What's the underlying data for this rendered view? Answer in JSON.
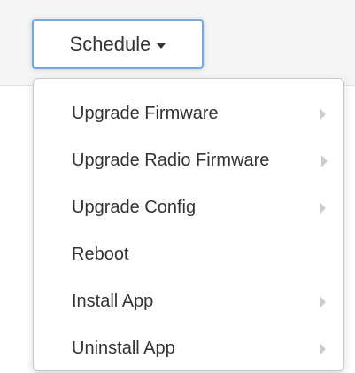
{
  "toolbar": {
    "schedule_label": "Schedule"
  },
  "menu": {
    "items": [
      {
        "label": "Upgrade Firmware",
        "has_submenu": true
      },
      {
        "label": "Upgrade Radio Firmware",
        "has_submenu": true
      },
      {
        "label": "Upgrade Config",
        "has_submenu": true
      },
      {
        "label": "Reboot",
        "has_submenu": false
      },
      {
        "label": "Install App",
        "has_submenu": true
      },
      {
        "label": "Uninstall App",
        "has_submenu": true
      }
    ]
  },
  "colors": {
    "button_border": "#7aa7d6",
    "text": "#333333",
    "submenu_arrow": "#cccccc"
  },
  "icons": {
    "caret": "caret-down-icon",
    "submenu": "chevron-right-icon"
  }
}
